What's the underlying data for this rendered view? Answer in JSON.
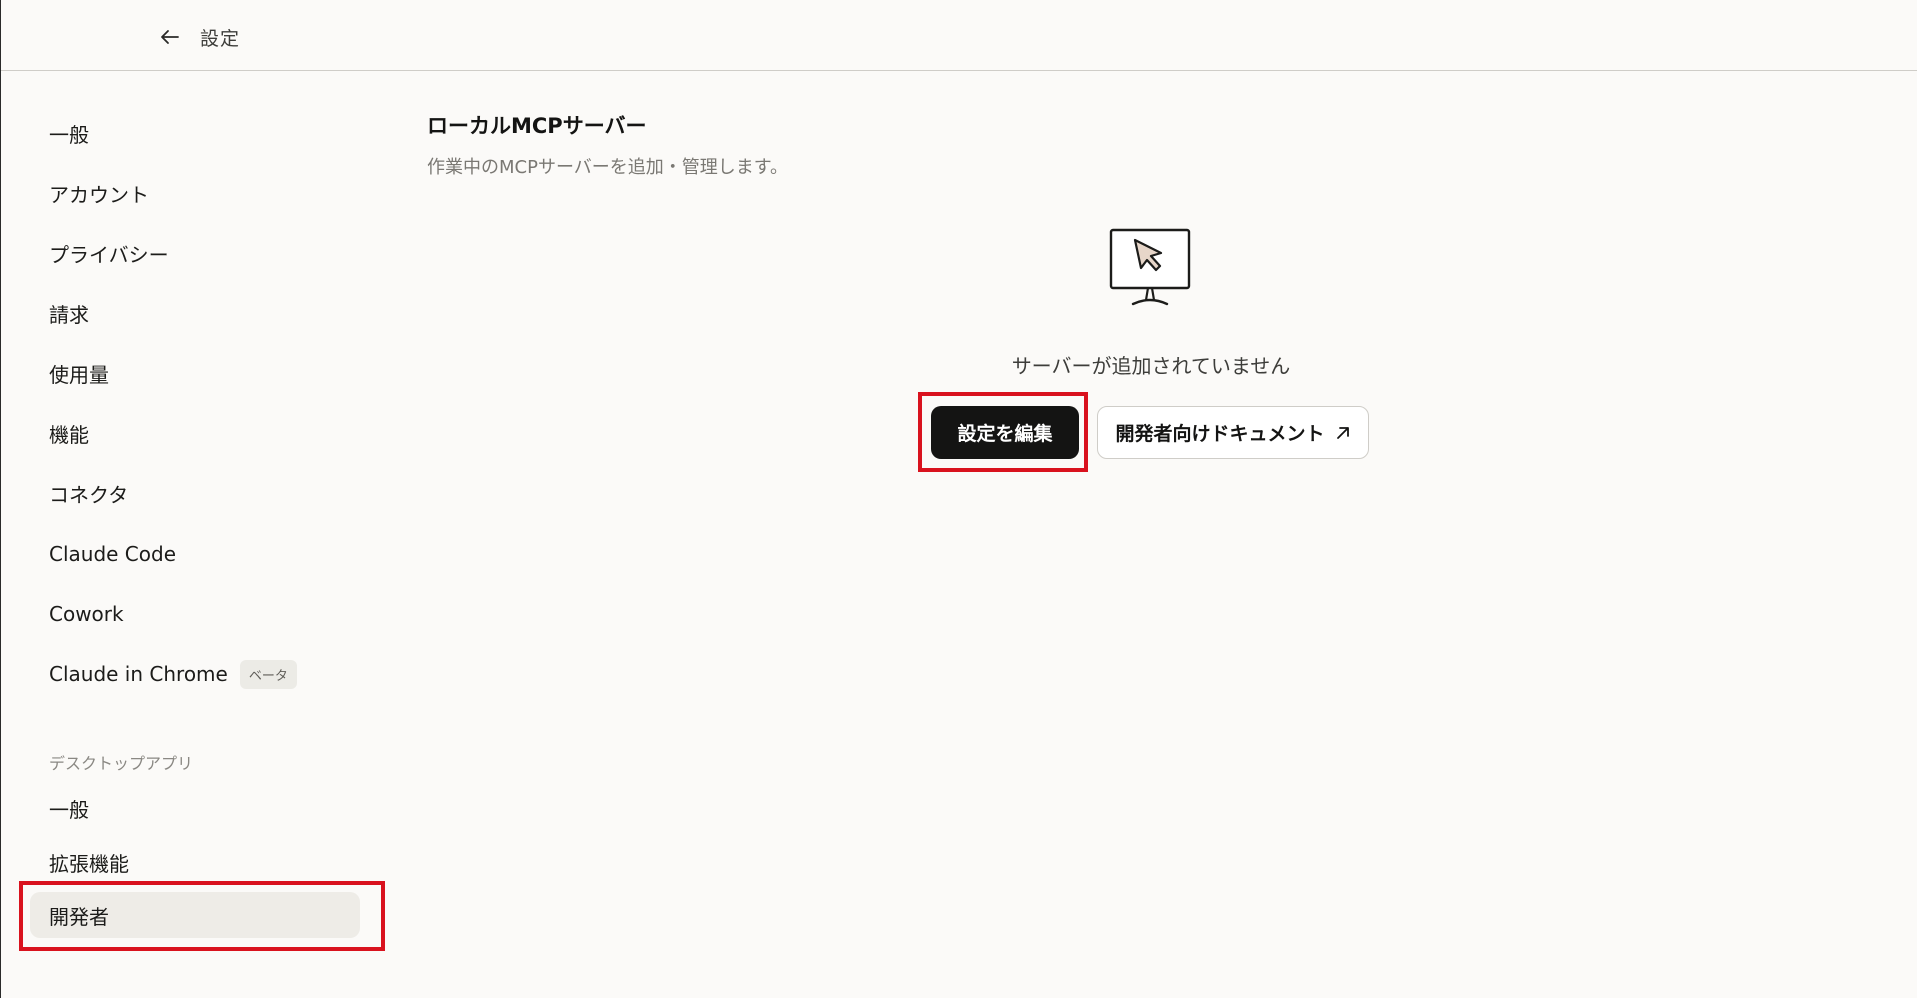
{
  "header": {
    "title": "設定",
    "back_icon": "arrow-left-icon"
  },
  "sidebar": {
    "items": [
      {
        "label": "一般"
      },
      {
        "label": "アカウント"
      },
      {
        "label": "プライバシー"
      },
      {
        "label": "請求"
      },
      {
        "label": "使用量"
      },
      {
        "label": "機能"
      },
      {
        "label": "コネクタ"
      },
      {
        "label": "Claude Code"
      },
      {
        "label": "Cowork"
      },
      {
        "label": "Claude in Chrome",
        "badge": "ベータ"
      }
    ],
    "desktop_section_label": "デスクトップアプリ",
    "desktop_items": [
      {
        "label": "一般"
      },
      {
        "label": "拡張機能"
      },
      {
        "label": "開発者",
        "active": true
      }
    ]
  },
  "main": {
    "title": "ローカルMCPサーバー",
    "description": "作業中のMCPサーバーを追加・管理します。",
    "empty_icon": "monitor-cursor-icon",
    "empty_text": "サーバーが追加されていません",
    "edit_button": "設定を編集",
    "docs_button": "開発者向けドキュメント",
    "docs_icon": "external-arrow-icon"
  },
  "colors": {
    "background": "#fbfaf8",
    "primary_button": "#141413",
    "highlight": "#d9121e",
    "active_nav": "#eeece7"
  }
}
